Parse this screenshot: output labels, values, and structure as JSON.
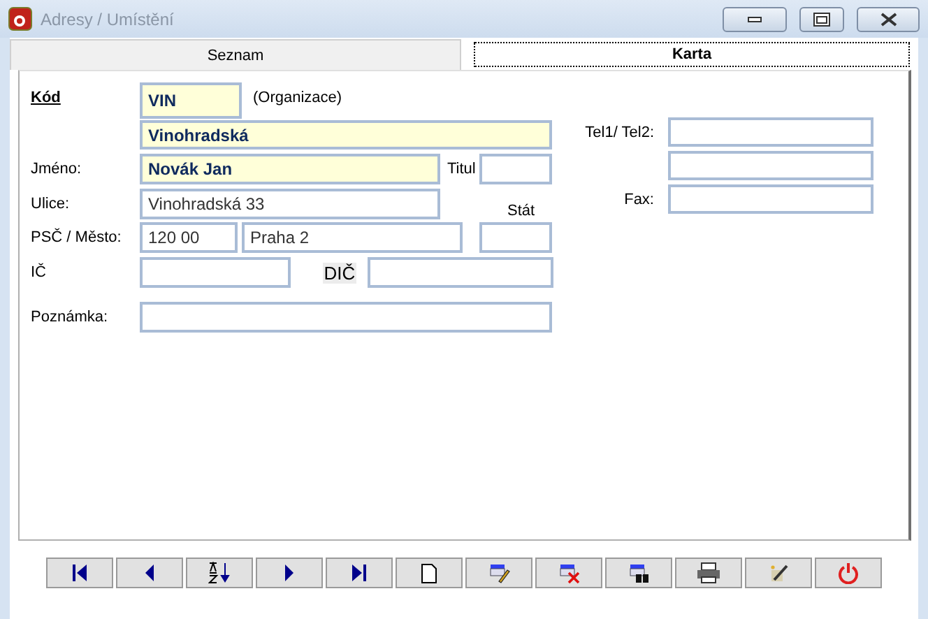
{
  "window": {
    "title": "Adresy / Umístění"
  },
  "tabs": [
    {
      "label": "Seznam",
      "selected": false
    },
    {
      "label": "Karta",
      "selected": true
    }
  ],
  "form": {
    "left_rows": [
      {
        "items": [
          {
            "kind": "key",
            "text": "Kód"
          },
          {
            "kind": "field",
            "value": "VIN",
            "highlighted": true
          },
          {
            "kind": "note",
            "text": "(Organizace)"
          }
        ]
      },
      {
        "items": [
          {
            "kind": "field",
            "value": "Vinohradská",
            "highlighted": true
          }
        ]
      },
      {
        "items": [
          {
            "kind": "label",
            "text": "Jméno:"
          },
          {
            "kind": "field",
            "value": "Novák Jan",
            "highlighted": true
          },
          {
            "kind": "label",
            "text": "Titul"
          },
          {
            "kind": "field",
            "highlighted": false
          }
        ]
      },
      {
        "items": [
          {
            "kind": "label",
            "text": "Ulice:"
          },
          {
            "kind": "field",
            "value": "Vinohradská 33",
            "highlighted": false
          },
          {
            "kind": "label",
            "text": "Stát"
          }
        ]
      },
      {
        "items": [
          {
            "kind": "label",
            "text": "PSČ / Město:"
          },
          {
            "kind": "field",
            "value": "120 00",
            "highlighted": false
          },
          {
            "kind": "field",
            "value": "Praha 2",
            "highlighted": false
          },
          {
            "kind": "field",
            "highlighted": false
          }
        ]
      },
      {
        "items": [
          {
            "kind": "label",
            "text": "IČ"
          },
          {
            "kind": "field",
            "highlighted": false
          },
          {
            "kind": "tag",
            "text": "DIČ"
          },
          {
            "kind": "field",
            "highlighted": false
          }
        ]
      },
      {
        "items": [
          {
            "kind": "label",
            "text": "Poznámka:"
          },
          {
            "kind": "field",
            "highlighted": false
          }
        ]
      }
    ],
    "right_rows": [
      {
        "label": "Tel1/ Tel2:",
        "field": {
          "highlighted": false
        }
      },
      {
        "field": {
          "highlighted": false
        }
      },
      {
        "label": "Fax:",
        "field": {
          "highlighted": false
        }
      }
    ]
  }
}
